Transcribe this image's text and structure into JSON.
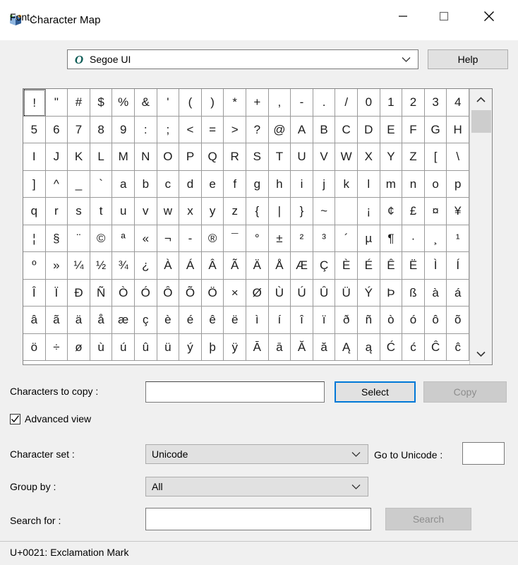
{
  "window": {
    "title": "Character Map",
    "icon": "character-map-icon",
    "controls": {
      "minimize": "minimize-icon",
      "maximize": "maximize-icon",
      "close": "close-icon"
    }
  },
  "font_row": {
    "label": "Font :",
    "value": "Segoe UI",
    "type_icon": "O",
    "type_icon_color": "#0d5c56",
    "help_label": "Help"
  },
  "grid": {
    "columns": 20,
    "focused_index": 0,
    "rows": [
      [
        "!",
        "\"",
        "#",
        "$",
        "%",
        "&",
        "'",
        "(",
        ")",
        "*",
        "+",
        ",",
        "-",
        ".",
        "/",
        "0",
        "1",
        "2",
        "3",
        "4"
      ],
      [
        "5",
        "6",
        "7",
        "8",
        "9",
        ":",
        ";",
        "<",
        "=",
        ">",
        "?",
        "@",
        "A",
        "B",
        "C",
        "D",
        "E",
        "F",
        "G",
        "H"
      ],
      [
        "I",
        "J",
        "K",
        "L",
        "M",
        "N",
        "O",
        "P",
        "Q",
        "R",
        "S",
        "T",
        "U",
        "V",
        "W",
        "X",
        "Y",
        "Z",
        "[",
        "\\"
      ],
      [
        "]",
        "^",
        "_",
        "`",
        "a",
        "b",
        "c",
        "d",
        "e",
        "f",
        "g",
        "h",
        "i",
        "j",
        "k",
        "l",
        "m",
        "n",
        "o",
        "p"
      ],
      [
        "q",
        "r",
        "s",
        "t",
        "u",
        "v",
        "w",
        "x",
        "y",
        "z",
        "{",
        "|",
        "}",
        "~",
        "",
        "¡",
        "¢",
        "£",
        "¤",
        "¥"
      ],
      [
        "¦",
        "§",
        "¨",
        "©",
        "ª",
        "«",
        "¬",
        "­-",
        "®",
        "¯",
        "°",
        "±",
        "²",
        "³",
        "´",
        "µ",
        "¶",
        "·",
        "¸",
        "¹"
      ],
      [
        "º",
        "»",
        "¼",
        "½",
        "¾",
        "¿",
        "À",
        "Á",
        "Â",
        "Ã",
        "Ä",
        "Å",
        "Æ",
        "Ç",
        "È",
        "É",
        "Ê",
        "Ë",
        "Ì",
        "Í"
      ],
      [
        "Î",
        "Ï",
        "Ð",
        "Ñ",
        "Ò",
        "Ó",
        "Ô",
        "Õ",
        "Ö",
        "×",
        "Ø",
        "Ù",
        "Ú",
        "Û",
        "Ü",
        "Ý",
        "Þ",
        "ß",
        "à",
        "á"
      ],
      [
        "â",
        "ã",
        "ä",
        "å",
        "æ",
        "ç",
        "è",
        "é",
        "ê",
        "ë",
        "ì",
        "í",
        "î",
        "ï",
        "ð",
        "ñ",
        "ò",
        "ó",
        "ô",
        "õ"
      ],
      [
        "ö",
        "÷",
        "ø",
        "ù",
        "ú",
        "û",
        "ü",
        "ý",
        "þ",
        "ÿ",
        "Ā",
        "ā",
        "Ă",
        "ă",
        "Ą",
        "ą",
        "Ć",
        "ć",
        "Ĉ",
        "ĉ"
      ]
    ],
    "scrollbar": {
      "up_icon": "chevron-up-icon",
      "down_icon": "chevron-down-icon"
    }
  },
  "copy_row": {
    "label": "Characters to copy :",
    "value": "",
    "select_label": "Select",
    "copy_label": "Copy",
    "copy_disabled": true,
    "select_focused": true
  },
  "advanced_view": {
    "label": "Advanced view",
    "checked": true
  },
  "character_set": {
    "label": "Character set :",
    "value": "Unicode"
  },
  "go_to_unicode": {
    "label": "Go to Unicode :",
    "value": ""
  },
  "group_by": {
    "label": "Group by :",
    "value": "All"
  },
  "search": {
    "label": "Search for :",
    "value": "",
    "button_label": "Search",
    "button_disabled": true
  },
  "status": {
    "text": "U+0021: Exclamation Mark"
  },
  "colors": {
    "window_bg": "#f0f0f0",
    "titlebar_bg": "#ffffff",
    "focus_blue": "#0078d7",
    "disabled_text": "#8d8d8d",
    "grid_line": "#9a9a9a"
  }
}
